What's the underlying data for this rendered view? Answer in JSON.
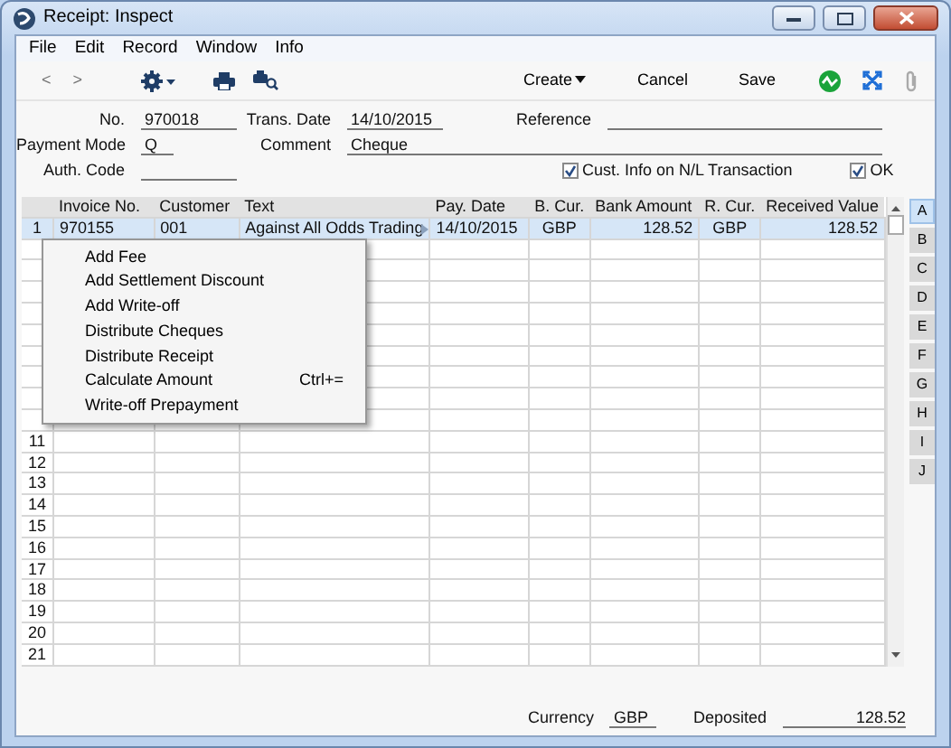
{
  "window": {
    "title": "Receipt: Inspect"
  },
  "menu": [
    "File",
    "Edit",
    "Record",
    "Window",
    "Info"
  ],
  "toolbar": {
    "nav": [
      "<",
      ">"
    ],
    "buttons": [
      {
        "label": "Create",
        "dropdown": true
      },
      {
        "label": "Cancel",
        "dropdown": false
      },
      {
        "label": "Save",
        "dropdown": false
      }
    ]
  },
  "form": {
    "rows": [
      [
        {
          "label": "No.",
          "value": "970018"
        },
        {
          "label": "Trans. Date",
          "value": "14/10/2015"
        },
        {
          "label": "Reference"
        }
      ],
      [
        {
          "label": "Payment Mode",
          "value": "Q"
        },
        {
          "label": "Comment",
          "value": "Cheque"
        }
      ],
      [
        {
          "label": "Auth. Code"
        }
      ]
    ],
    "checkboxes": [
      {
        "label": "Cust. Info on N/L Transaction",
        "checked": true
      },
      {
        "label": "OK",
        "checked": true
      }
    ]
  },
  "table": {
    "columns": [
      "Invoice No.",
      "Customer",
      "Text",
      "Pay. Date",
      "B. Cur.",
      "Bank Amount",
      "R. Cur.",
      "Received Value"
    ],
    "rows": [
      {
        "number": "1",
        "selected": true,
        "cells": [
          "970155",
          "001",
          "Against All Odds Trading",
          "14/10/2015",
          "GBP",
          "128.52",
          "GBP",
          "128.52"
        ]
      },
      {
        "selected": false
      },
      {
        "selected": false
      },
      {
        "selected": false
      },
      {
        "selected": false
      },
      {
        "selected": false
      },
      {
        "selected": false
      },
      {
        "selected": false
      },
      {
        "selected": false
      },
      {
        "selected": false
      },
      {
        "number": "11",
        "selected": false
      },
      {
        "number": "12",
        "selected": false
      },
      {
        "number": "13",
        "selected": false
      },
      {
        "number": "14",
        "selected": false
      },
      {
        "number": "15",
        "selected": false
      },
      {
        "number": "16",
        "selected": false
      },
      {
        "number": "17",
        "selected": false
      },
      {
        "number": "18",
        "selected": false
      },
      {
        "number": "19",
        "selected": false
      },
      {
        "number": "20",
        "selected": false
      },
      {
        "number": "21",
        "selected": false
      }
    ]
  },
  "side_tabs": [
    {
      "label": "A",
      "selected": true
    },
    {
      "label": "B",
      "selected": false
    },
    {
      "label": "C",
      "selected": false
    },
    {
      "label": "D",
      "selected": false
    },
    {
      "label": "E",
      "selected": false
    },
    {
      "label": "F",
      "selected": false
    },
    {
      "label": "G",
      "selected": false
    },
    {
      "label": "H",
      "selected": false
    },
    {
      "label": "I",
      "selected": false
    },
    {
      "label": "J",
      "selected": false
    }
  ],
  "context_menu": [
    {
      "label": "Add Fee"
    },
    {
      "label": "Add Settlement Discount"
    },
    {
      "label": "Add Write-off"
    },
    {
      "label": "Distribute Cheques"
    },
    {
      "label": "Distribute Receipt"
    },
    {
      "label": "Calculate Amount",
      "shortcut": "Ctrl+="
    },
    {
      "label": "Write-off Prepayment"
    }
  ],
  "footer": [
    {
      "label": "Currency",
      "value": "GBP"
    },
    {
      "label": "Deposited",
      "value": "128.52"
    }
  ]
}
